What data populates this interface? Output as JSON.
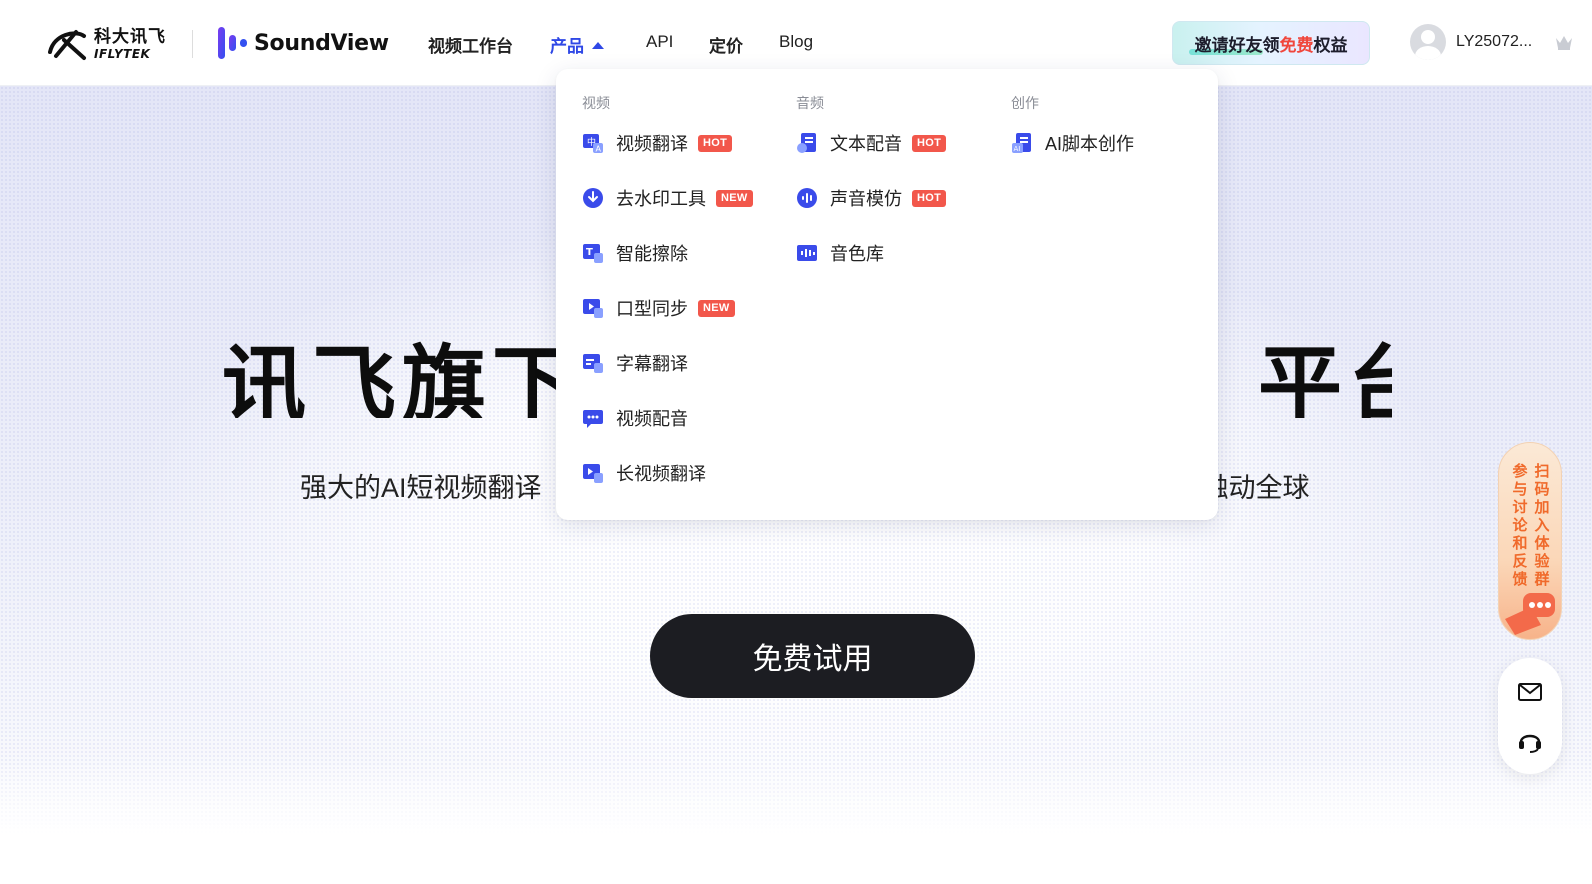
{
  "header": {
    "brand_cn": "科大讯飞",
    "brand_en": "IFLYTEK",
    "product_name": "SoundView",
    "nav": {
      "workbench": "视频工作台",
      "products": "产品",
      "api": "API",
      "pricing": "定价",
      "blog": "Blog"
    },
    "invite": {
      "part1": "邀请好友",
      "part2": "领",
      "part3": "免费",
      "part4": "权益"
    },
    "username": "LY25072..."
  },
  "dropdown": {
    "columns": [
      {
        "heading": "视频",
        "items": [
          {
            "label": "视频翻译",
            "tag": "HOT",
            "icon": "video-translate-icon"
          },
          {
            "label": "去水印工具",
            "tag": "NEW",
            "icon": "watermark-remove-icon"
          },
          {
            "label": "智能擦除",
            "tag": "",
            "icon": "smart-erase-icon"
          },
          {
            "label": "口型同步",
            "tag": "NEW",
            "icon": "lip-sync-icon"
          },
          {
            "label": "字幕翻译",
            "tag": "",
            "icon": "subtitle-translate-icon"
          },
          {
            "label": "视频配音",
            "tag": "",
            "icon": "video-dubbing-icon"
          },
          {
            "label": "长视频翻译",
            "tag": "",
            "icon": "long-video-translate-icon"
          }
        ]
      },
      {
        "heading": "音频",
        "items": [
          {
            "label": "文本配音",
            "tag": "HOT",
            "icon": "text-dubbing-icon"
          },
          {
            "label": "声音模仿",
            "tag": "HOT",
            "icon": "voice-clone-icon"
          },
          {
            "label": "音色库",
            "tag": "",
            "icon": "voice-library-icon"
          }
        ]
      },
      {
        "heading": "创作",
        "items": [
          {
            "label": "AI脚本创作",
            "tag": "",
            "icon": "ai-script-icon"
          }
        ]
      }
    ]
  },
  "hero": {
    "title_left": "讯飞旗下",
    "title_right": "平台",
    "subtitle_left": "强大的AI短视频翻译",
    "subtitle_right": "触动全球",
    "cta": "免费试用"
  },
  "floating": {
    "promo_line1": "扫码加入体验群",
    "promo_line2": "参与讨论和反馈"
  },
  "colors": {
    "accent": "#2f48e6",
    "tag": "#f2574b",
    "cta_bg": "#1c1d22"
  }
}
